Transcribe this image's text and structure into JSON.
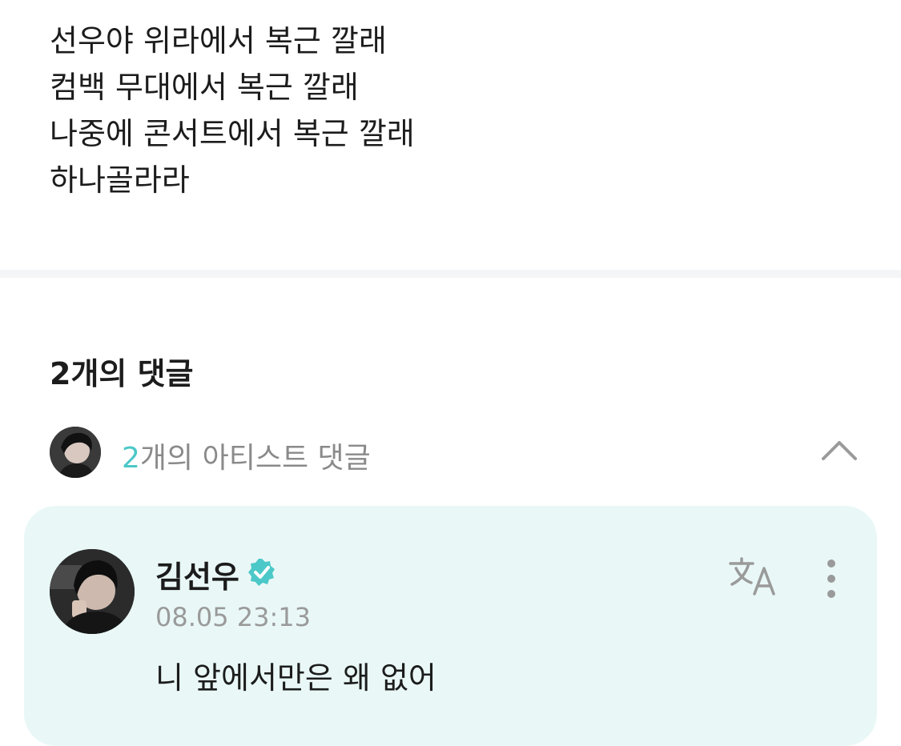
{
  "post": {
    "lines": [
      "선우야 위라에서 복근 깔래",
      "컴백 무대에서 복근 깔래",
      "나중에 콘서트에서 복근 깔래",
      "하나골라라"
    ]
  },
  "comments": {
    "title": "2개의 댓글",
    "artist_row": {
      "count": "2",
      "label": "개의 아티스트 댓글",
      "expanded_icon": "chevron-up-icon"
    },
    "items": [
      {
        "author": "김선우",
        "verified_icon": "verified-badge-icon",
        "timestamp": "08.05 23:13",
        "text": "니 앞에서만은 왜 없어",
        "translate_icon": "translate-icon",
        "more_icon": "more-vertical-icon"
      }
    ]
  },
  "colors": {
    "accent": "#4cc8c8",
    "card_bg": "#e9f8f7",
    "muted": "#8a8a8a",
    "divider": "#f4f5f7"
  }
}
